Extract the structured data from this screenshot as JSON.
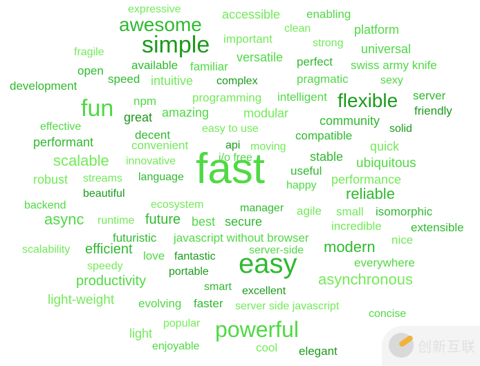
{
  "words": [
    {
      "text": "expressive"
    },
    {
      "text": "accessible"
    },
    {
      "text": "enabling"
    },
    {
      "text": "awesome"
    },
    {
      "text": "clean"
    },
    {
      "text": "platform"
    },
    {
      "text": "important"
    },
    {
      "text": "simple"
    },
    {
      "text": "strong"
    },
    {
      "text": "universal"
    },
    {
      "text": "fragile"
    },
    {
      "text": "versatile"
    },
    {
      "text": "perfect"
    },
    {
      "text": "swiss army knife"
    },
    {
      "text": "available"
    },
    {
      "text": "familiar"
    },
    {
      "text": "open"
    },
    {
      "text": "speed"
    },
    {
      "text": "intuitive"
    },
    {
      "text": "complex"
    },
    {
      "text": "pragmatic"
    },
    {
      "text": "sexy"
    },
    {
      "text": "development"
    },
    {
      "text": "programming"
    },
    {
      "text": "intelligent"
    },
    {
      "text": "flexible"
    },
    {
      "text": "server"
    },
    {
      "text": "npm"
    },
    {
      "text": "fun"
    },
    {
      "text": "friendly"
    },
    {
      "text": "amazing"
    },
    {
      "text": "modular"
    },
    {
      "text": "great"
    },
    {
      "text": "community"
    },
    {
      "text": "effective"
    },
    {
      "text": "solid"
    },
    {
      "text": "easy to use"
    },
    {
      "text": "decent"
    },
    {
      "text": "compatible"
    },
    {
      "text": "performant"
    },
    {
      "text": "convenient"
    },
    {
      "text": "api"
    },
    {
      "text": "moving"
    },
    {
      "text": "quick"
    },
    {
      "text": "i/o free"
    },
    {
      "text": "stable"
    },
    {
      "text": "scalable"
    },
    {
      "text": "innovative"
    },
    {
      "text": "fast"
    },
    {
      "text": "ubiquitous"
    },
    {
      "text": "useful"
    },
    {
      "text": "robust"
    },
    {
      "text": "streams"
    },
    {
      "text": "language"
    },
    {
      "text": "performance"
    },
    {
      "text": "happy"
    },
    {
      "text": "beautiful"
    },
    {
      "text": "reliable"
    },
    {
      "text": "backend"
    },
    {
      "text": "ecosystem"
    },
    {
      "text": "manager"
    },
    {
      "text": "agile"
    },
    {
      "text": "small"
    },
    {
      "text": "isomorphic"
    },
    {
      "text": "async"
    },
    {
      "text": "runtime"
    },
    {
      "text": "future"
    },
    {
      "text": "best"
    },
    {
      "text": "secure"
    },
    {
      "text": "incredible"
    },
    {
      "text": "extensible"
    },
    {
      "text": "futuristic"
    },
    {
      "text": "javascript without browser"
    },
    {
      "text": "nice"
    },
    {
      "text": "scalability"
    },
    {
      "text": "efficient"
    },
    {
      "text": "server-side"
    },
    {
      "text": "modern"
    },
    {
      "text": "love"
    },
    {
      "text": "fantastic"
    },
    {
      "text": "easy"
    },
    {
      "text": "everywhere"
    },
    {
      "text": "speedy"
    },
    {
      "text": "portable"
    },
    {
      "text": "productivity"
    },
    {
      "text": "asynchronous"
    },
    {
      "text": "smart"
    },
    {
      "text": "excellent"
    },
    {
      "text": "light-weight"
    },
    {
      "text": "evolving"
    },
    {
      "text": "faster"
    },
    {
      "text": "server side javascript"
    },
    {
      "text": "concise"
    },
    {
      "text": "popular"
    },
    {
      "text": "powerful"
    },
    {
      "text": "light"
    },
    {
      "text": "enjoyable"
    },
    {
      "text": "cool"
    },
    {
      "text": "elegant"
    }
  ],
  "palette": {
    "dark": "#1a9a1a",
    "medium": "#2fb92f",
    "light": "#4fd944",
    "lightest": "#72ea58"
  },
  "watermark": {
    "text": "创新互联"
  }
}
